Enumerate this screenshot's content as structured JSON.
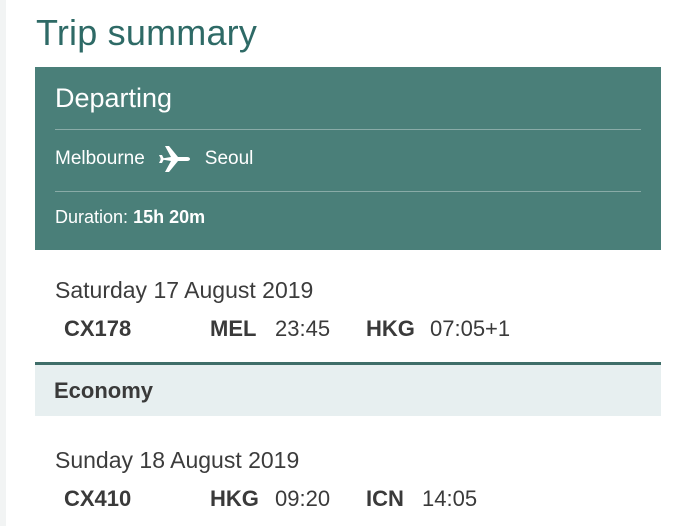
{
  "title": "Trip summary",
  "departing": {
    "heading": "Departing",
    "origin": "Melbourne",
    "destination": "Seoul",
    "duration_label": "Duration:",
    "duration_value": "15h 20m",
    "icon": "plane-icon"
  },
  "segments": [
    {
      "date": "Saturday 17 August 2019",
      "flight": "CX178",
      "from_code": "MEL",
      "depart_time": "23:45",
      "to_code": "HKG",
      "arrive_time": "07:05+1"
    },
    {
      "date": "Sunday 18 August 2019",
      "flight": "CX410",
      "from_code": "HKG",
      "depart_time": "09:20",
      "to_code": "ICN",
      "arrive_time": "14:05"
    }
  ],
  "cabin": {
    "label": "Economy"
  },
  "colors": {
    "accent": "#2e6a66",
    "card": "#4a7f79",
    "cabin_bar": "#e7eff0"
  }
}
